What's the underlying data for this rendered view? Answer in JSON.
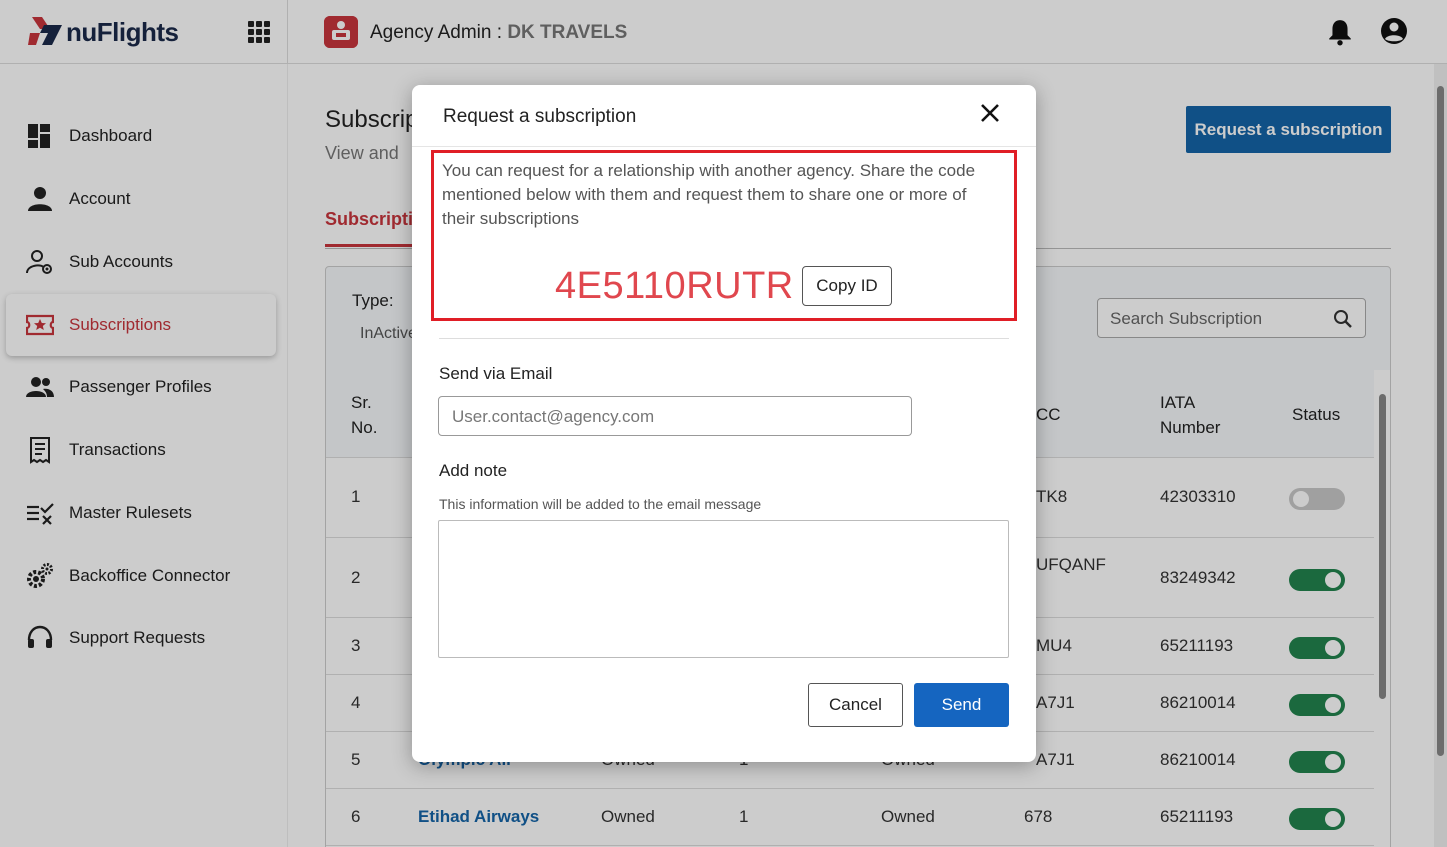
{
  "header": {
    "logo_text": "nuFlights",
    "agency_label": "Agency Admin :",
    "agency_name": "DK TRAVELS"
  },
  "sidebar": {
    "items": [
      {
        "label": "Dashboard",
        "icon": "dashboard-icon"
      },
      {
        "label": "Account",
        "icon": "person-icon"
      },
      {
        "label": "Sub Accounts",
        "icon": "sub-accounts-icon"
      },
      {
        "label": "Subscriptions",
        "icon": "ticket-icon",
        "active": true
      },
      {
        "label": "Passenger Profiles",
        "icon": "people-icon"
      },
      {
        "label": "Transactions",
        "icon": "receipt-icon"
      },
      {
        "label": "Master Rulesets",
        "icon": "rules-icon"
      },
      {
        "label": "Backoffice Connector",
        "icon": "gears-icon"
      },
      {
        "label": "Support Requests",
        "icon": "headset-icon"
      }
    ]
  },
  "main": {
    "title": "Subscriptions",
    "subtitle": "View and",
    "request_button": "Request a subscription",
    "tab": "Subscriptions",
    "type_label": "Type:",
    "inactive_label": "InActive",
    "search_placeholder": "Search Subscription",
    "columns": {
      "srno": "Sr. No.",
      "cc": "CC",
      "iata": "IATA Number",
      "status": "Status"
    },
    "rows": [
      {
        "sr": "1",
        "name": "",
        "type": "",
        "count": "",
        "ownership": "",
        "cc": "TK8",
        "iata": "42303310",
        "status": "off"
      },
      {
        "sr": "2",
        "name": "",
        "type": "",
        "count": "",
        "ownership": "",
        "cc": "UFQANF",
        "iata": "83249342",
        "status": "on"
      },
      {
        "sr": "3",
        "name": "",
        "type": "",
        "count": "",
        "ownership": "",
        "cc": "MU4",
        "iata": "65211193",
        "status": "on"
      },
      {
        "sr": "4",
        "name": "",
        "type": "",
        "count": "",
        "ownership": "",
        "cc": "A7J1",
        "iata": "86210014",
        "status": "on"
      },
      {
        "sr": "5",
        "name": "Olympic Air",
        "type": "Owned",
        "count": "1",
        "ownership": "Owned",
        "cc": "A7J1",
        "iata": "86210014",
        "status": "on"
      },
      {
        "sr": "6",
        "name": "Etihad Airways",
        "type": "Owned",
        "count": "1",
        "ownership": "Owned",
        "cc": "678",
        "iata": "65211193",
        "status": "on"
      }
    ]
  },
  "modal": {
    "title": "Request a subscription",
    "description": "You can request for a relationship with another agency. Share the code mentioned below with them and request them to share one or more of their subscriptions",
    "code": "4E5110RUTR",
    "copy_button": "Copy ID",
    "email_label": "Send via Email",
    "email_placeholder": "User.contact@agency.com",
    "note_label": "Add note",
    "note_hint": "This information will be added to the email message",
    "cancel_button": "Cancel",
    "send_button": "Send"
  },
  "colors": {
    "brand_red": "#c8353d",
    "highlight_red": "#e01e26",
    "primary_blue": "#1565c0",
    "toggle_green": "#22844e"
  }
}
